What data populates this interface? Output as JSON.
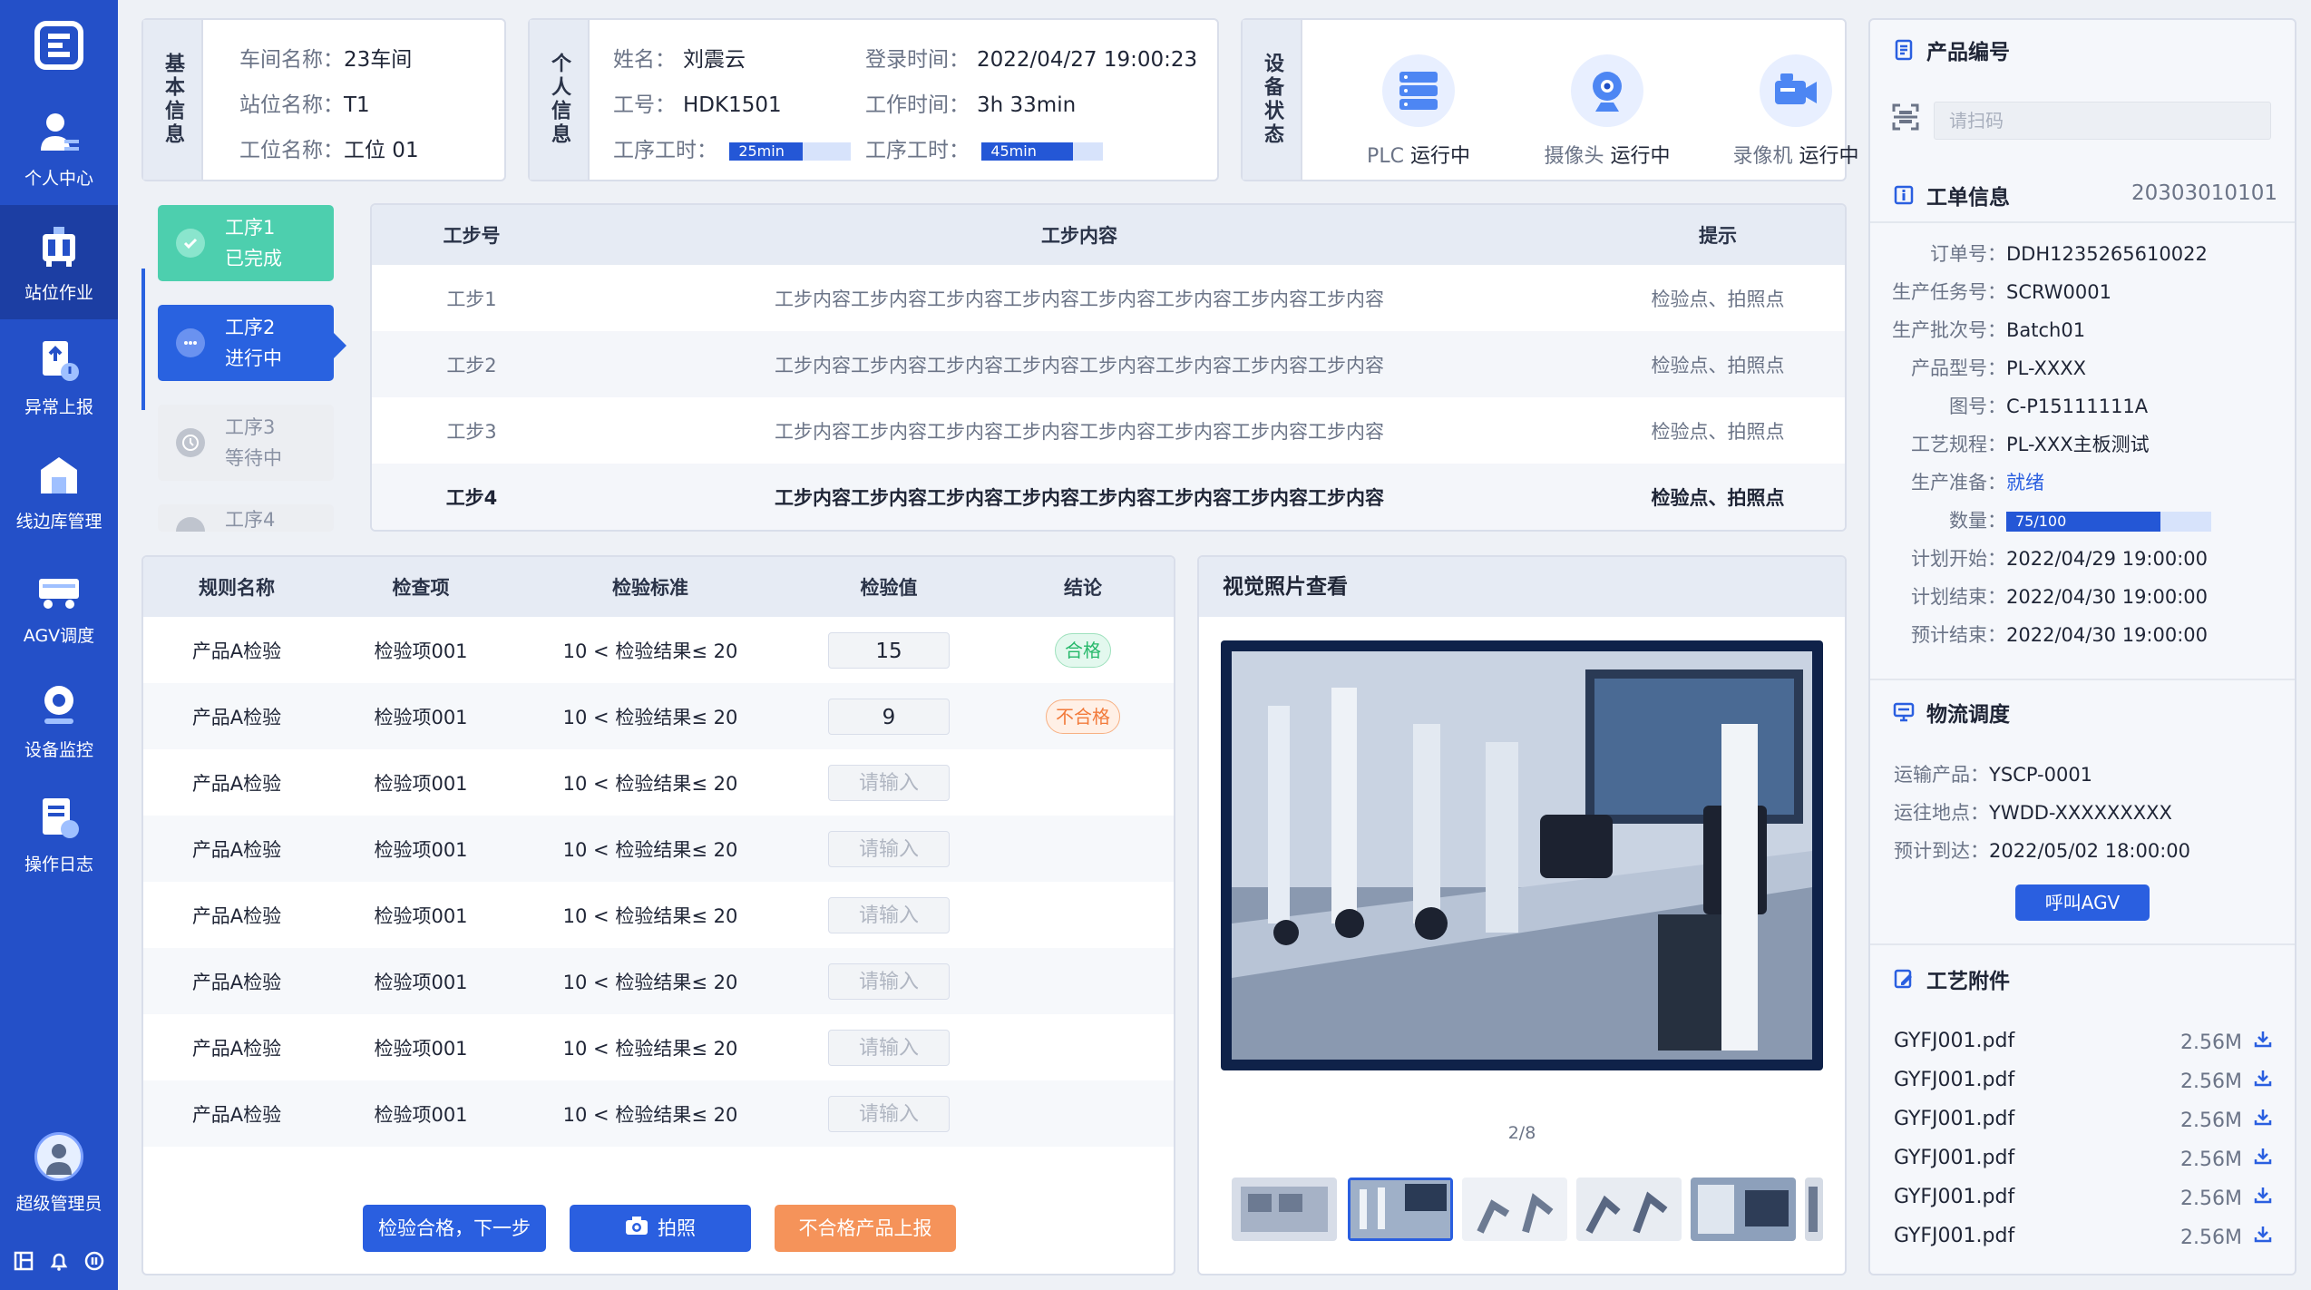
{
  "sidebar": {
    "items": [
      {
        "label": "个人中心",
        "icon": "person-icon"
      },
      {
        "label": "站位作业",
        "icon": "workstation-icon"
      },
      {
        "label": "异常上报",
        "icon": "exception-report-icon"
      },
      {
        "label": "线边库管理",
        "icon": "warehouse-icon"
      },
      {
        "label": "AGV调度",
        "icon": "agv-icon"
      },
      {
        "label": "设备监控",
        "icon": "monitor-icon"
      },
      {
        "label": "操作日志",
        "icon": "log-icon"
      }
    ],
    "user_label": "超级管理员"
  },
  "basic_info": {
    "title": "基本信息",
    "workshop_key": "车间名称：",
    "workshop_val": "23车间",
    "station_key": "站位名称：",
    "station_val": "T1",
    "position_key": "工位名称：",
    "position_val": "工位 01"
  },
  "personal_info": {
    "title": "个人信息",
    "name_key": "姓名：",
    "name_val": "刘震云",
    "login_key": "登录时间：",
    "login_val": "2022/04/27 19:00:23",
    "id_key": "工号：",
    "id_val": "HDK1501",
    "worktime_key": "工作时间：",
    "worktime_val": "3h 33min",
    "proc_time_key1": "工序工时：",
    "proc_time_val1": "25min",
    "proc_time_fill1": 0.6,
    "proc_time_key2": "工序工时：",
    "proc_time_val2": "45min",
    "proc_time_fill2": 0.75
  },
  "device_status": {
    "title": "设备状态",
    "devices": [
      {
        "name": "PLC",
        "status": "运行中"
      },
      {
        "name": "摄像头",
        "status": "运行中"
      },
      {
        "name": "录像机",
        "status": "运行中"
      }
    ]
  },
  "processes": [
    {
      "name": "工序1",
      "state": "已完成"
    },
    {
      "name": "工序2",
      "state": "进行中"
    },
    {
      "name": "工序3",
      "state": "等待中"
    },
    {
      "name": "工序4",
      "state": ""
    }
  ],
  "step_table": {
    "headers": [
      "工步号",
      "工步内容",
      "提示"
    ],
    "rows": [
      [
        "工步1",
        "工步内容工步内容工步内容工步内容工步内容工步内容工步内容工步内容",
        "检验点、拍照点"
      ],
      [
        "工步2",
        "工步内容工步内容工步内容工步内容工步内容工步内容工步内容工步内容",
        "检验点、拍照点"
      ],
      [
        "工步3",
        "工步内容工步内容工步内容工步内容工步内容工步内容工步内容工步内容",
        "检验点、拍照点"
      ],
      [
        "工步4",
        "工步内容工步内容工步内容工步内容工步内容工步内容工步内容工步内容",
        "检验点、拍照点"
      ]
    ]
  },
  "check_table": {
    "headers": [
      "规则名称",
      "检查项",
      "检验标准",
      "检验值",
      "结论"
    ],
    "placeholder": "请输入",
    "rows": [
      {
        "rule": "产品A检验",
        "item": "检验项001",
        "standard": "10 < 检验结果≤ 20",
        "value": "15",
        "result": "合格"
      },
      {
        "rule": "产品A检验",
        "item": "检验项001",
        "standard": "10 < 检验结果≤ 20",
        "value": "9",
        "result": "不合格"
      },
      {
        "rule": "产品A检验",
        "item": "检验项001",
        "standard": "10 < 检验结果≤ 20",
        "value": "",
        "result": ""
      },
      {
        "rule": "产品A检验",
        "item": "检验项001",
        "standard": "10 < 检验结果≤ 20",
        "value": "",
        "result": ""
      },
      {
        "rule": "产品A检验",
        "item": "检验项001",
        "standard": "10 < 检验结果≤ 20",
        "value": "",
        "result": ""
      },
      {
        "rule": "产品A检验",
        "item": "检验项001",
        "standard": "10 < 检验结果≤ 20",
        "value": "",
        "result": ""
      },
      {
        "rule": "产品A检验",
        "item": "检验项001",
        "standard": "10 < 检验结果≤ 20",
        "value": "",
        "result": ""
      },
      {
        "rule": "产品A检验",
        "item": "检验项001",
        "standard": "10 < 检验结果≤ 20",
        "value": "",
        "result": ""
      }
    ],
    "buttons": {
      "pass_next": "检验合格，下一步",
      "photo": "拍照",
      "report_ng": "不合格产品上报"
    }
  },
  "photo_viewer": {
    "title": "视觉照片查看",
    "page": "2/8"
  },
  "product": {
    "title": "产品编号",
    "scan_placeholder": "请扫码"
  },
  "work_order": {
    "title": "工单信息",
    "code": "20303010101",
    "fields": [
      {
        "k": "订单号：",
        "v": "DDH1235265610022"
      },
      {
        "k": "生产任务号：",
        "v": "SCRW0001"
      },
      {
        "k": "生产批次号：",
        "v": "Batch01"
      },
      {
        "k": "产品型号：",
        "v": "PL-XXXX"
      },
      {
        "k": "图号：",
        "v": "C-P15111111A"
      },
      {
        "k": "工艺规程：",
        "v": "PL-XXX主板测试"
      },
      {
        "k": "生产准备：",
        "v": "就绪"
      },
      {
        "k": "数量：",
        "v": "75/100"
      },
      {
        "k": "计划开始：",
        "v": "2022/04/29 19:00:00"
      },
      {
        "k": "计划结束：",
        "v": "2022/04/30 19:00:00"
      },
      {
        "k": "预计结束：",
        "v": "2022/04/30 19:00:00"
      }
    ],
    "quantity_fill": 0.75
  },
  "logistics": {
    "title": "物流调度",
    "fields": [
      {
        "k": "运输产品：",
        "v": "YSCP-0001"
      },
      {
        "k": "运往地点：",
        "v": "YWDD-XXXXXXXXX"
      },
      {
        "k": "预计到达：",
        "v": "2022/05/02 18:00:00"
      }
    ],
    "call_button": "呼叫AGV"
  },
  "attachments": {
    "title": "工艺附件",
    "files": [
      {
        "name": "GYFJ001.pdf",
        "size": "2.56M"
      },
      {
        "name": "GYFJ001.pdf",
        "size": "2.56M"
      },
      {
        "name": "GYFJ001.pdf",
        "size": "2.56M"
      },
      {
        "name": "GYFJ001.pdf",
        "size": "2.56M"
      },
      {
        "name": "GYFJ001.pdf",
        "size": "2.56M"
      },
      {
        "name": "GYFJ001.pdf",
        "size": "2.56M"
      }
    ]
  },
  "colors": {
    "brand": "#2450c8",
    "accent": "#2a5fe0",
    "ok": "#27b96b",
    "ng": "#f27a3a",
    "done": "#4dcfae"
  }
}
